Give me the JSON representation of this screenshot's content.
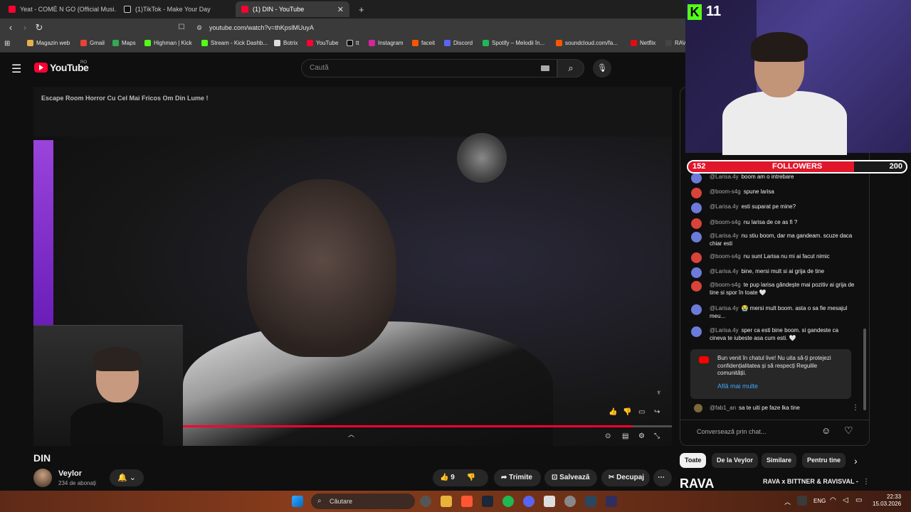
{
  "browser": {
    "tabs": [
      {
        "label": "Yeat - COMÈ N GO (Official Musi...",
        "active": false
      },
      {
        "label": "(1)TikTok - Make Your Day",
        "active": false
      },
      {
        "label": "(1) DIN - YouTube",
        "active": true
      }
    ],
    "new_tab": "+",
    "url": "youtube.com/watch?v=thKpslMUuyA",
    "bookmarks": [
      "Magazin web",
      "Gmail",
      "Maps",
      "Highman | Kick",
      "Stream - Kick Dashb...",
      "Botrix",
      "YouTube",
      "tt",
      "Instagram",
      "faceit",
      "Discord",
      "Spotify – Melodii în...",
      "soundcloud.com/fa...",
      "Netflix",
      "RAV"
    ]
  },
  "youtube": {
    "logo": "YouTube",
    "region": "RO",
    "search_placeholder": "Caută"
  },
  "video": {
    "overlay_title": "Escape Room Horror Cu Cel Mai Fricos Om Din Lume !",
    "progress": 0.92,
    "title": "DIN",
    "channel": "Veylor",
    "subscribers": "234 de abonați",
    "likes": "9",
    "actions": {
      "share": "Trimite",
      "save": "Salvează",
      "clip": "Decupaj",
      "more": "⋯"
    }
  },
  "chat": {
    "messages": [
      {
        "author": "@Larisa.4y",
        "text": "boom am o intrebare",
        "color": "#6c7bd9"
      },
      {
        "author": "@boom-s4g",
        "text": "spune larisa",
        "color": "#d9433a"
      },
      {
        "author": "@Larisa.4y",
        "text": "esti suparat pe mine?",
        "color": "#6c7bd9"
      },
      {
        "author": "@boom-s4g",
        "text": "nu larisa de ce as fi ?",
        "color": "#d9433a"
      },
      {
        "author": "@Larisa.4y",
        "text": "nu stiu boom, dar ma gandeam. scuze daca chiar esti",
        "color": "#6c7bd9"
      },
      {
        "author": "@boom-s4g",
        "text": "nu sunt Larisa nu mi ai facut nimic",
        "color": "#d9433a"
      },
      {
        "author": "@Larisa.4y",
        "text": "bine, mersi mult si ai grija de tine",
        "color": "#6c7bd9"
      },
      {
        "author": "@boom-s4g",
        "text": "te pup larisa gândește mai pozitiv ai grija de tine si spor în toate 🤍",
        "color": "#d9433a"
      },
      {
        "author": "@Larisa.4y",
        "text": "😭 mersi mult boom. asta o sa fie mesajul meu...",
        "color": "#6c7bd9"
      },
      {
        "author": "@Larisa.4y",
        "text": "sper ca esti bine boom. si gandeste ca cineva te iubeste asa cum esti. 🤍",
        "color": "#6c7bd9"
      }
    ],
    "notice": "Bun venit în chatul live! Nu uita să-ți protejezi confidențialitatea și să respecți Regulile comunității.",
    "notice_link": "Află mai multe",
    "last": {
      "author": "@fab1_an",
      "text": "sa te uiti pe faze lka tine"
    },
    "input_placeholder": "Conversează prin chat..."
  },
  "overlay": {
    "kick_viewers": "11",
    "followers_current": "152",
    "followers_label": "FOLLOWERS",
    "followers_goal": "200",
    "followers_fraction": 0.76
  },
  "chips": [
    "Toate",
    "De la Veylor",
    "Similare",
    "Pentru tine"
  ],
  "related_title": "RAVA x BITTNER & RAVISVAL -",
  "related_thumb_text": "RAVA",
  "taskbar": {
    "search": "Căutare",
    "lang": "ENG",
    "time": "22:33",
    "date": "15.03.2026"
  }
}
